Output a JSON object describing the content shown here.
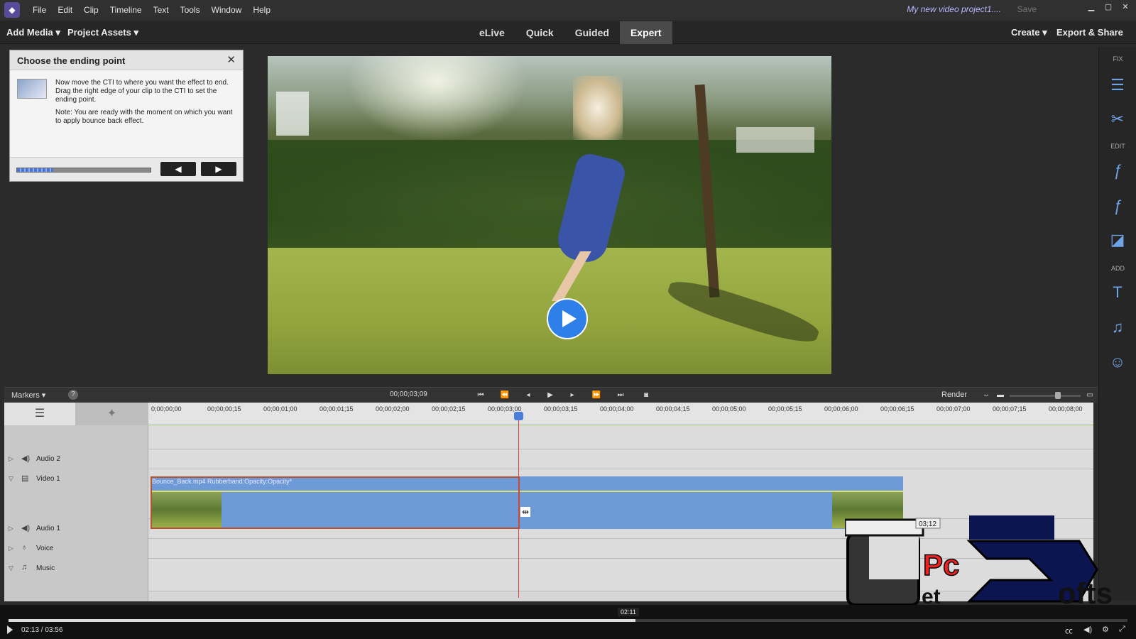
{
  "menubar": {
    "items": [
      "File",
      "Edit",
      "Clip",
      "Timeline",
      "Text",
      "Tools",
      "Window",
      "Help"
    ],
    "title": "My new video project1....",
    "save": "Save"
  },
  "toolbar": {
    "add_media": "Add Media ▾",
    "project_assets": "Project Assets ▾",
    "tabs": [
      "eLive",
      "Quick",
      "Guided",
      "Expert"
    ],
    "active_tab": "Expert",
    "create": "Create ▾",
    "export_share": "Export & Share"
  },
  "guide": {
    "title": "Choose the ending point",
    "text1": "Now move the CTI to where you want the effect to end. Drag the right edge of your clip to the CTI to set the ending point.",
    "text2": "Note: You are ready with the moment on which you want to apply bounce back effect.",
    "progress_fraction": 0.27,
    "prev": "◀",
    "next": "▶"
  },
  "right_panel": {
    "fix": "FIX",
    "edit": "EDIT",
    "add": "ADD"
  },
  "timeline_bar": {
    "markers": "Markers ▾",
    "help": "?",
    "timecode": "00;00;03;09",
    "render": "Render"
  },
  "ruler_ticks": [
    "0;00;00;00",
    "00;00;00;15",
    "00;00;01;00",
    "00;00;01;15",
    "00;00;02;00",
    "00;00;02;15",
    "00;00;03;00",
    "00;00;03;15",
    "00;00;04;00",
    "00;00;04;15",
    "00;00;05;00",
    "00;00;05;15",
    "00;00;06;00",
    "00;00;06;15",
    "00;00;07;00",
    "00;00;07;15",
    "00;00;08;00"
  ],
  "tracks": {
    "audio2": "Audio 2",
    "video1": "Video 1",
    "audio1": "Audio 1",
    "voice": "Voice",
    "music": "Music"
  },
  "clip": {
    "label": "Bounce_Back.mp4 Rubberband:Opacity:Opacity*",
    "tooltip": "03;12"
  },
  "watermark": {
    "text": "GetPcSofts"
  },
  "player": {
    "time": "02:13 / 03:56",
    "tooltip": "02:11",
    "progress_fraction": 0.56
  }
}
